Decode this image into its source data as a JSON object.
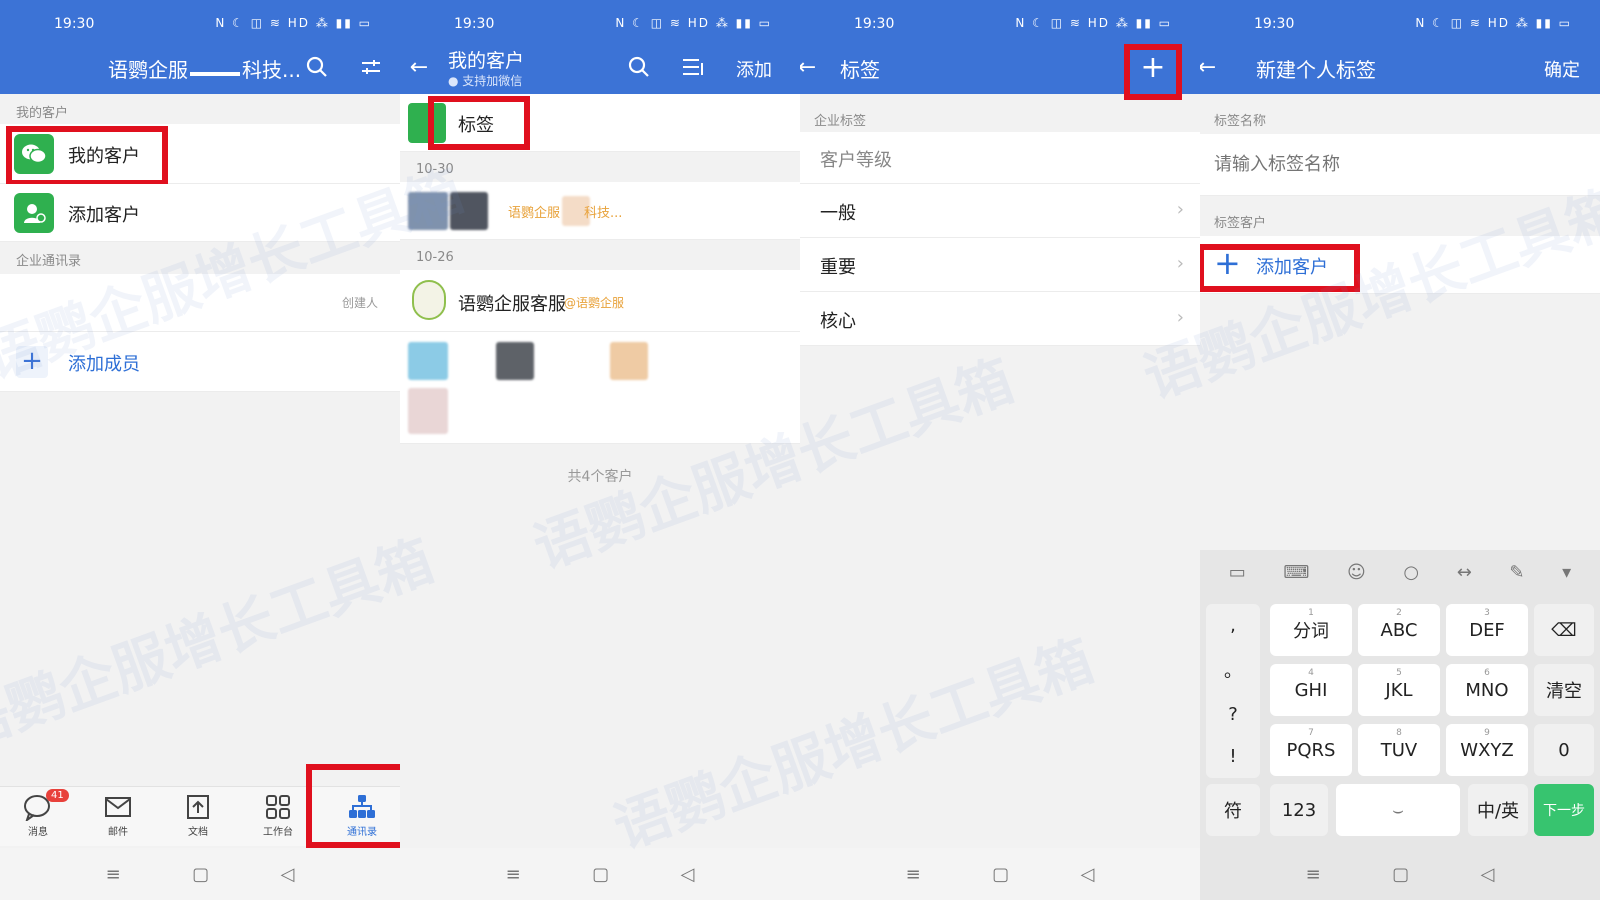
{
  "status": {
    "time": "19:30"
  },
  "panel1": {
    "title_left": "语鹦企服",
    "title_right": "科技...",
    "section_my_customers": "我的客户",
    "my_customers_label": "我的客户",
    "add_customer_label": "添加客户",
    "section_directory": "企业通讯录",
    "creator_tag": "创建人",
    "add_member_label": "添加成员",
    "nav": [
      {
        "label": "消息",
        "badge": "41"
      },
      {
        "label": "邮件"
      },
      {
        "label": "文档"
      },
      {
        "label": "工作台"
      },
      {
        "label": "通讯录"
      }
    ]
  },
  "panel2": {
    "title": "我的客户",
    "subtitle": "支持加微信",
    "add_label": "添加",
    "tag_label": "标签",
    "date1": "10-30",
    "row1_text": "语鹦企服",
    "row1_text_right": "科技...",
    "date2": "10-26",
    "row2_name": "语鹦企服客服",
    "row2_org": "@语鹦企服",
    "total_label": "共4个客户"
  },
  "panel3": {
    "title": "标签",
    "section_enterprise_tags": "企业标签",
    "group_label": "客户等级",
    "tags": [
      "一般",
      "重要",
      "核心"
    ]
  },
  "panel4": {
    "title": "新建个人标签",
    "confirm_label": "确定",
    "section_tag_name": "标签名称",
    "tag_name_placeholder": "请输入标签名称",
    "section_tag_customers": "标签客户",
    "add_customer_label": "添加客户",
    "keyboard": {
      "punct": [
        ",",
        "。",
        "?",
        "!"
      ],
      "keys": [
        {
          "num": "1",
          "label": "分词"
        },
        {
          "num": "2",
          "label": "ABC"
        },
        {
          "num": "3",
          "label": "DEF"
        },
        {
          "num": "4",
          "label": "GHI"
        },
        {
          "num": "5",
          "label": "JKL"
        },
        {
          "num": "6",
          "label": "MNO"
        },
        {
          "num": "7",
          "label": "PQRS"
        },
        {
          "num": "8",
          "label": "TUV"
        },
        {
          "num": "9",
          "label": "WXYZ"
        }
      ],
      "clear": "清空",
      "zero": "0",
      "symbol": "符",
      "num_switch": "123",
      "lang_switch": "中/英",
      "next": "下一步"
    }
  },
  "watermark": "语鹦企服增长工具箱",
  "colors": {
    "header": "#3c73d6",
    "red_highlight": "#e0101e",
    "wechat_green": "#2fb04f",
    "next_green": "#37c46f",
    "link_blue": "#2e6fd6",
    "orange_text": "#e8a23a"
  }
}
